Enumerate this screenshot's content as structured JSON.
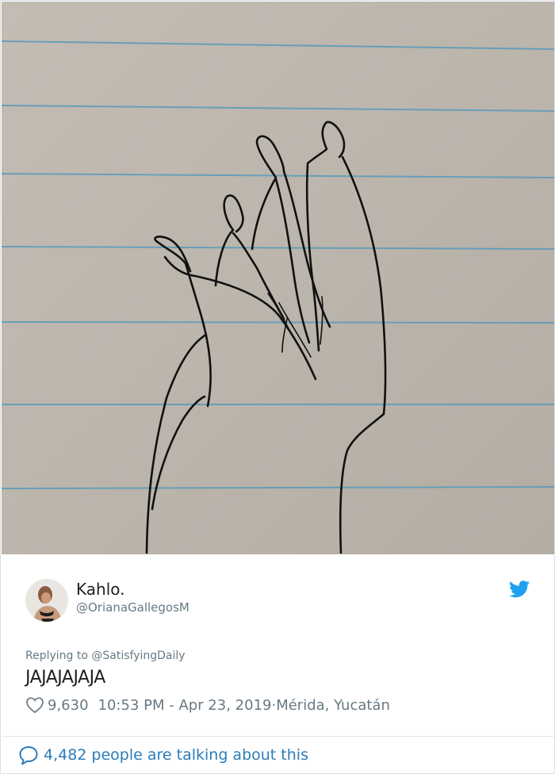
{
  "tweet": {
    "author": {
      "display_name": "Kahlo.",
      "handle": "@OrianaGallegosM"
    },
    "replying_to_prefix": "Replying to ",
    "replying_to_user": "@SatisfyingDaily",
    "text": "JAJAJAJAJA",
    "likes": "9,630",
    "timestamp": "10:53 PM - Apr 23, 2019",
    "separator": " · ",
    "location": "Mérida, Yucatán",
    "conversation_text": "4,482 people are talking about this"
  },
  "icons": {
    "brand": "twitter-bird-icon",
    "like": "heart-icon",
    "conversation": "speech-bubble-icon"
  },
  "colors": {
    "brand_blue": "#1da1f2",
    "link_blue": "#2b7bb9",
    "secondary_text": "#697882",
    "primary_text": "#1c2022",
    "paper": "#bcb6ad",
    "ruled_line": "#5a9bb8"
  }
}
